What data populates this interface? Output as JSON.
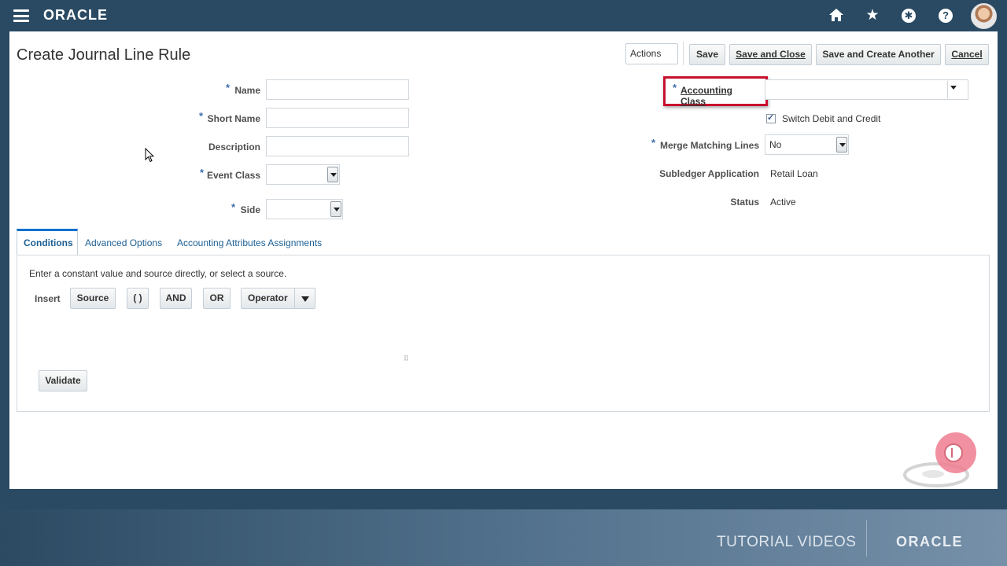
{
  "page": {
    "title": "Create Journal Line Rule"
  },
  "topbar": {
    "logo": "ORACLE",
    "icons": [
      "menu-icon",
      "home-icon",
      "star-icon",
      "accessibility-icon",
      "help-icon",
      "avatar"
    ]
  },
  "toolbar": {
    "actions": "Actions",
    "save": "Save",
    "save_and_close": "Save and Close",
    "save_and_create_another": "Save and Create Another",
    "cancel": "Cancel"
  },
  "form_left": {
    "name_label": "Name",
    "short_name_label": "Short Name",
    "description_label": "Description",
    "event_class_label": "Event Class",
    "side_label": "Side",
    "required_marker": "*"
  },
  "form_right": {
    "accounting_class_label": "Accounting Class",
    "switch_debit_credit_label": "Switch Debit and Credit",
    "switch_debit_credit_checked": true,
    "merge_matching_lines_label": "Merge Matching Lines",
    "merge_matching_lines_value": "No",
    "subledger_application_label": "Subledger Application",
    "subledger_application_value": "Retail Loan",
    "status_label": "Status",
    "status_value": "Active"
  },
  "tabs": [
    {
      "label": "Conditions",
      "active": true
    },
    {
      "label": "Advanced Options",
      "active": false
    },
    {
      "label": "Accounting Attributes Assignments",
      "active": false
    }
  ],
  "conditions": {
    "instructions": "Enter a constant value and source directly, or select a source.",
    "insert_label": "Insert",
    "source_button": "Source",
    "parens_button": "( )",
    "and_button": "AND",
    "or_button": "OR",
    "operator_button": "Operator",
    "validate_button": "Validate"
  },
  "footer": {
    "tutorial_label": "TUTORIAL VIDEOS",
    "logo": "ORACLE"
  },
  "colors": {
    "header_bg": "#2a4a63",
    "highlight": "#c8102e",
    "link": "#1c5f93",
    "required": "#3e6dad"
  }
}
